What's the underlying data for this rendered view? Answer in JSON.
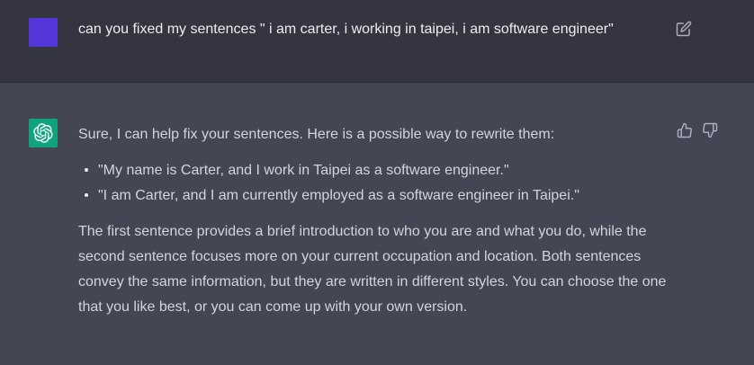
{
  "user_message": {
    "avatar_color": "#5436da",
    "text": "can you fixed my sentences \" i am carter, i working in taipei, i am software engineer\""
  },
  "assistant_message": {
    "avatar_color": "#10a37f",
    "intro": "Sure, I can help fix your sentences. Here is a possible way to rewrite them:",
    "bullets": [
      "\"My name is Carter, and I work in Taipei as a software engineer.\"",
      "\"I am Carter, and I am currently employed as a software engineer in Taipei.\""
    ],
    "paragraph": "The first sentence provides a brief introduction to who you are and what you do, while the second sentence focuses more on your current occupation and location. Both sentences convey the same information, but they are written in different styles. You can choose the one that you like best, or you can come up with your own version."
  },
  "icons": {
    "edit": "edit-icon",
    "thumbs_up": "thumbs-up-icon",
    "thumbs_down": "thumbs-down-icon",
    "assistant_logo": "openai-logo-icon"
  },
  "colors": {
    "user_bg": "#343541",
    "assistant_bg": "#444654",
    "text": "#d1d5db"
  }
}
